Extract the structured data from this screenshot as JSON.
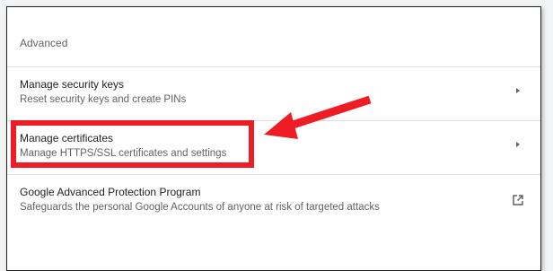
{
  "section": {
    "title": "Advanced"
  },
  "rows": [
    {
      "title": "Manage security keys",
      "subtitle": "Reset security keys and create PINs",
      "action_icon": "chevron-right-icon"
    },
    {
      "title": "Manage certificates",
      "subtitle": "Manage HTTPS/SSL certificates and settings",
      "action_icon": "chevron-right-icon"
    },
    {
      "title": "Google Advanced Protection Program",
      "subtitle": "Safeguards the personal Google Accounts of anyone at risk of targeted attacks",
      "action_icon": "open-in-new-icon"
    }
  ],
  "annotation": {
    "color": "#ee1c24"
  }
}
